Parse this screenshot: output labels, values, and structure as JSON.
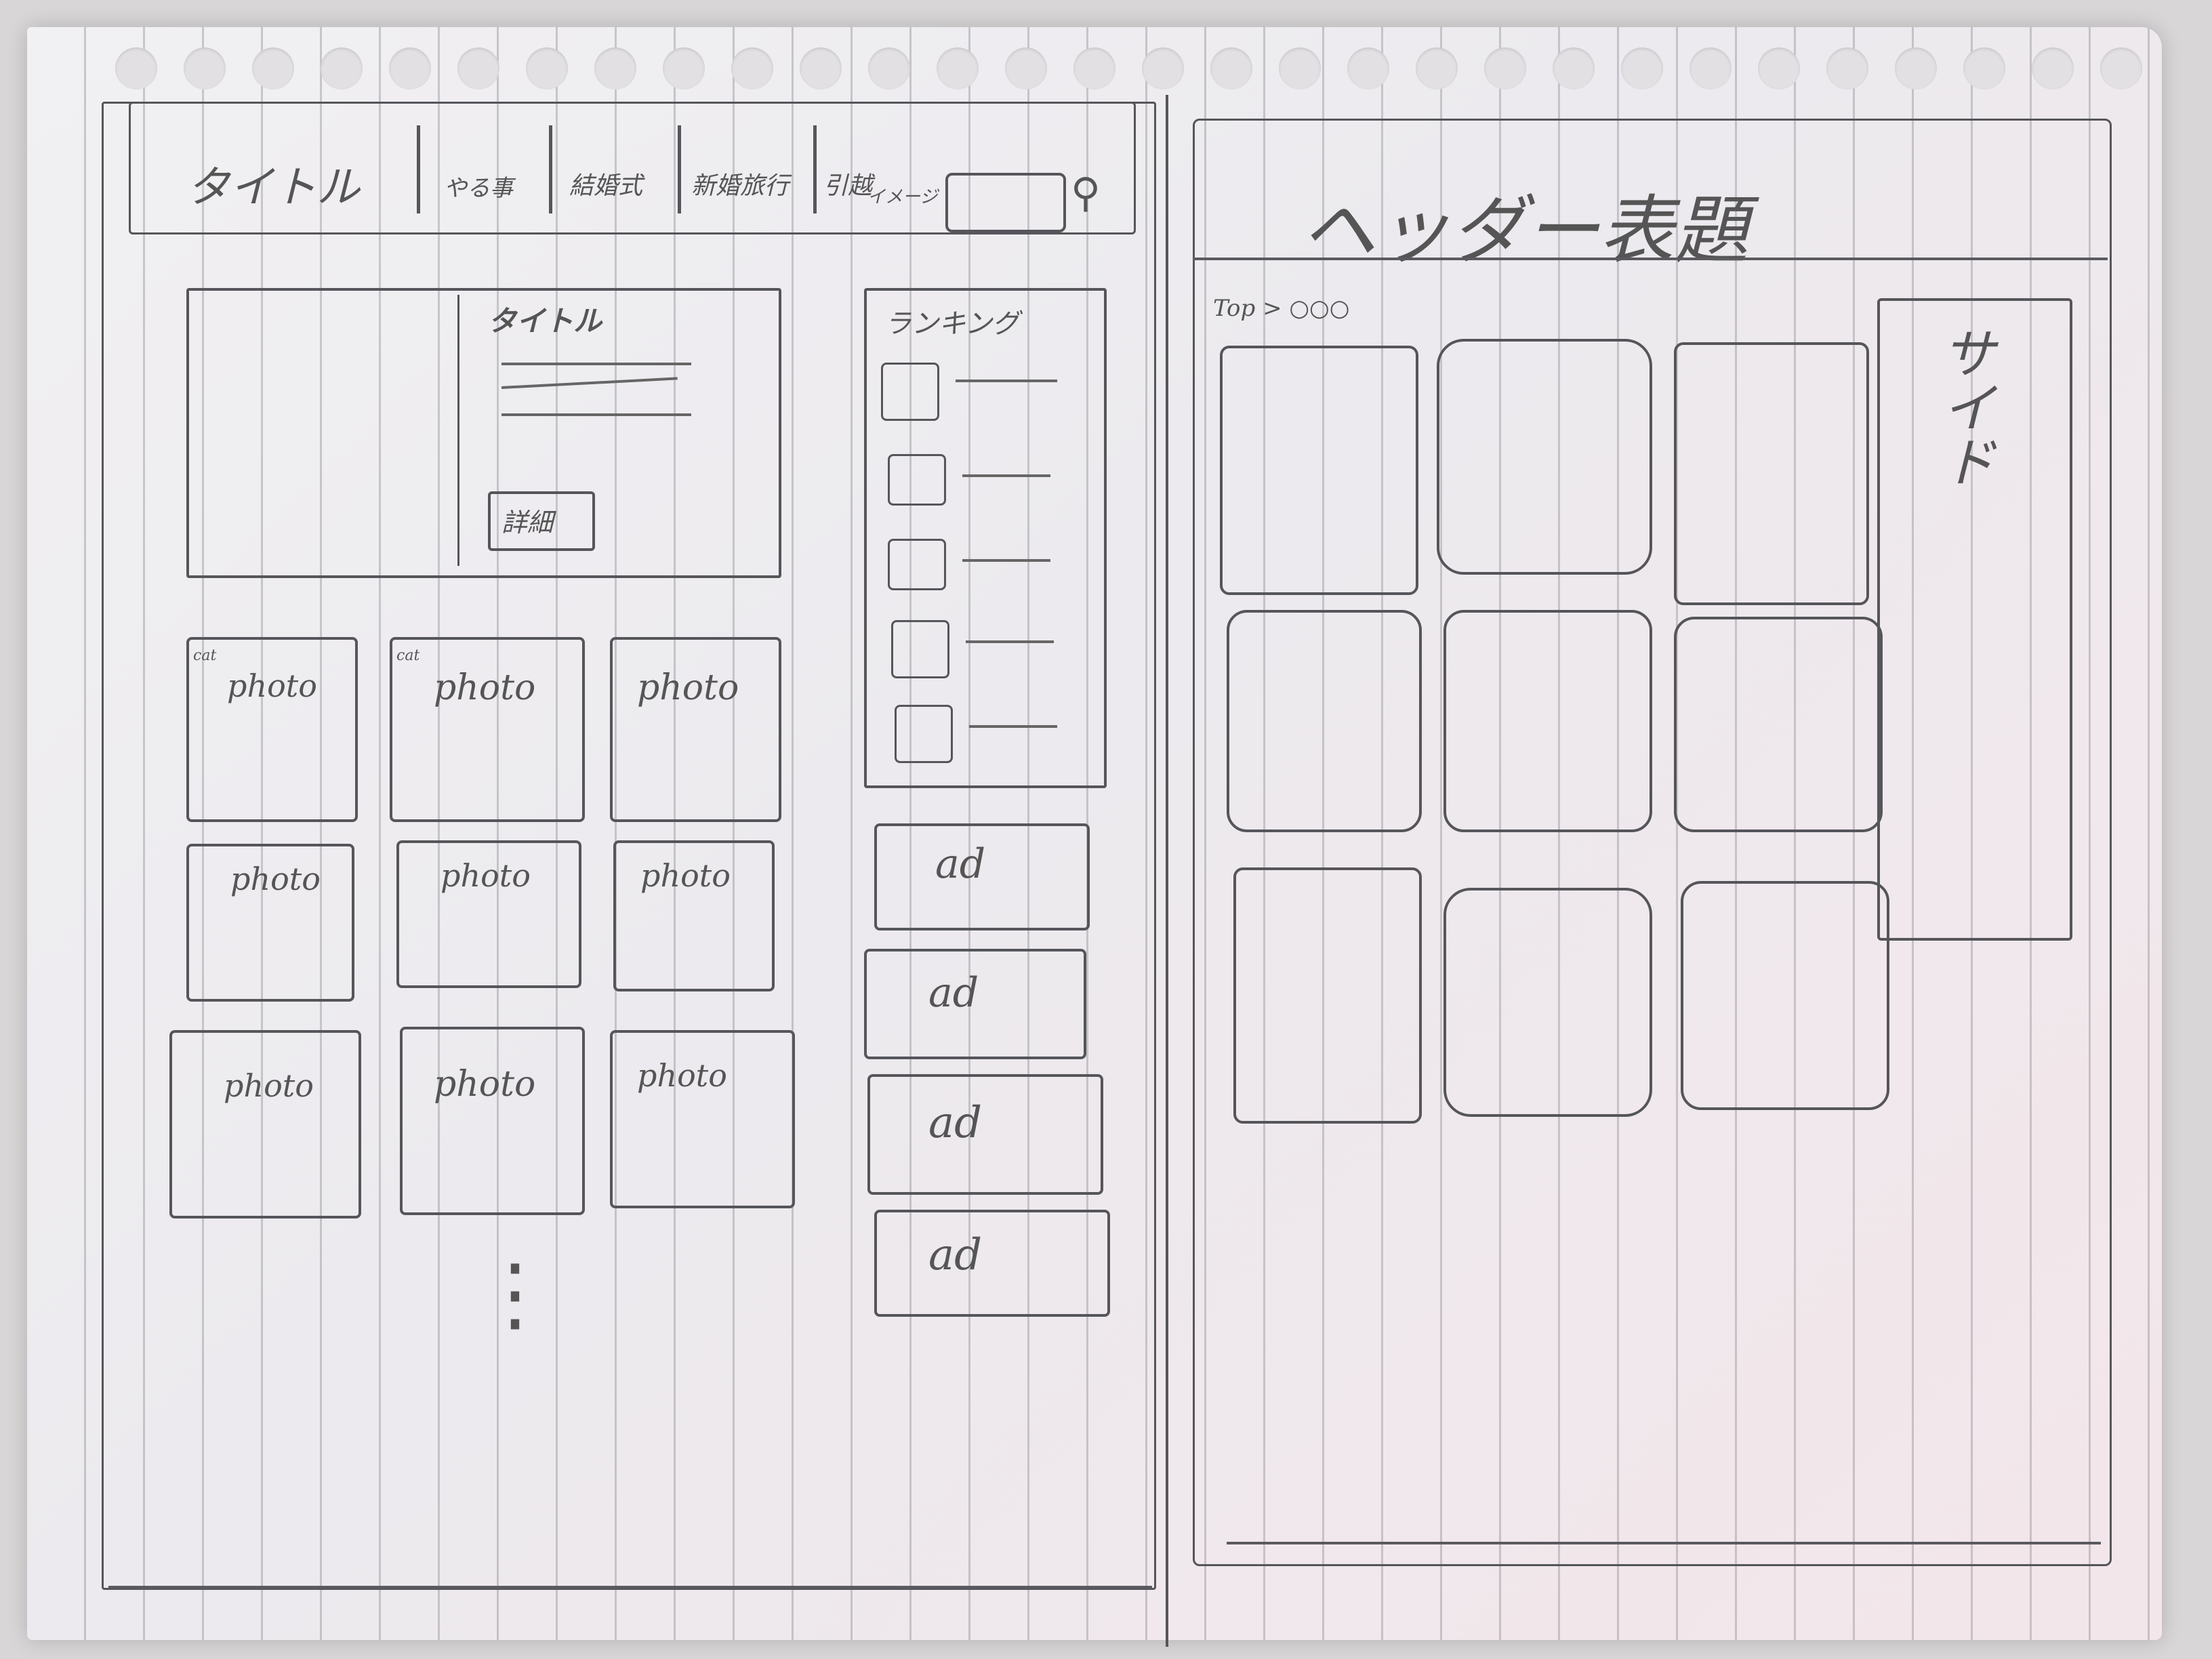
{
  "left_sketch": {
    "header": {
      "title": "タイトル",
      "nav": [
        "やる事",
        "結婚式",
        "新婚旅行",
        "引越",
        "イメージ"
      ]
    },
    "hero": {
      "photo_label": "",
      "title": "タイトル",
      "button": "詳細"
    },
    "ranking": {
      "title": "ランキング"
    },
    "cards": [
      {
        "photo": "photo",
        "badge": "cat"
      },
      {
        "photo": "photo",
        "badge": "cat"
      },
      {
        "photo": "photo",
        "badge": ""
      },
      {
        "photo": "photo",
        "badge": ""
      },
      {
        "photo": "photo",
        "badge": ""
      },
      {
        "photo": "photo",
        "badge": ""
      },
      {
        "photo": "photo",
        "badge": ""
      },
      {
        "photo": "photo",
        "badge": ""
      },
      {
        "photo": "photo",
        "badge": ""
      }
    ],
    "ads": [
      "ad",
      "ad",
      "ad",
      "ad"
    ],
    "ellipsis": "⋮"
  },
  "right_sketch": {
    "header_title": "ヘッダー表題",
    "breadcrumb": "Top > ○○○",
    "sidebar_label": "サイド"
  }
}
